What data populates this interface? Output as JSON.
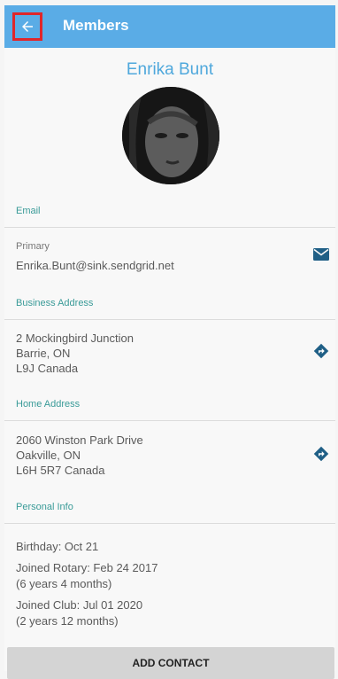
{
  "appbar": {
    "title": "Members"
  },
  "member": {
    "name": "Enrika Bunt"
  },
  "email": {
    "section_label": "Email",
    "type_label": "Primary",
    "address": "Enrika.Bunt@sink.sendgrid.net"
  },
  "business_address": {
    "section_label": "Business Address",
    "line1": "2 Mockingbird Junction",
    "line2": "Barrie, ON",
    "line3": "L9J Canada"
  },
  "home_address": {
    "section_label": "Home Address",
    "line1": "2060 Winston Park Drive",
    "line2": "Oakville, ON",
    "line3": "L6H 5R7 Canada"
  },
  "personal_info": {
    "section_label": "Personal Info",
    "birthday": "Birthday: Oct 21",
    "joined_rotary": "Joined Rotary: Feb 24 2017",
    "joined_rotary_duration": "(6 years 4 months)",
    "joined_club": "Joined Club: Jul 01 2020",
    "joined_club_duration": "(2 years 12 months)"
  },
  "actions": {
    "add_contact_label": "ADD CONTACT"
  },
  "colors": {
    "appbar": "#5aace6",
    "accent_name": "#4fa8dc",
    "section_label": "#3a9b98",
    "icon": "#1f5f86",
    "highlight_border": "#e0262a"
  },
  "icons": {
    "back": "arrow-left-icon",
    "email": "envelope-icon",
    "directions": "directions-icon"
  }
}
